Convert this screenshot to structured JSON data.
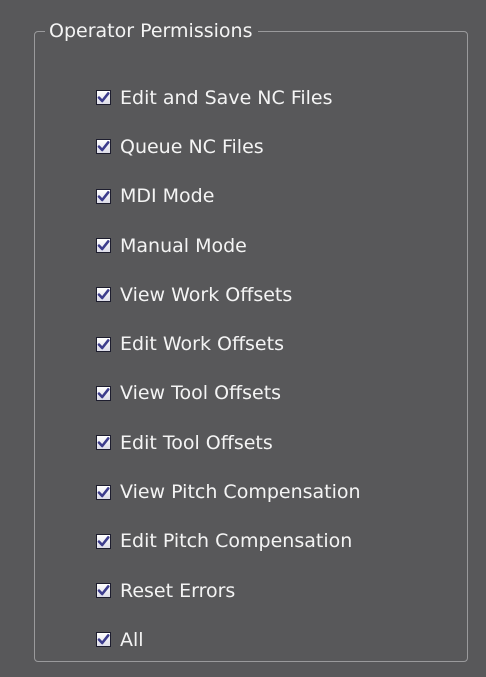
{
  "group": {
    "title": "Operator Permissions"
  },
  "colors": {
    "background": "#58585a",
    "border": "#9a9a9c",
    "text": "#f4f4f4",
    "checkmark": "#3c3c8c"
  },
  "permissions": [
    {
      "label": "Edit and Save NC Files",
      "checked": true
    },
    {
      "label": "Queue NC Files",
      "checked": true
    },
    {
      "label": "MDI Mode",
      "checked": true
    },
    {
      "label": "Manual Mode",
      "checked": true
    },
    {
      "label": "View Work Offsets",
      "checked": true
    },
    {
      "label": "Edit Work Offsets",
      "checked": true
    },
    {
      "label": "View Tool Offsets",
      "checked": true
    },
    {
      "label": "Edit Tool Offsets",
      "checked": true
    },
    {
      "label": "View Pitch Compensation",
      "checked": true
    },
    {
      "label": "Edit Pitch Compensation",
      "checked": true
    },
    {
      "label": "Reset Errors",
      "checked": true
    },
    {
      "label": "All",
      "checked": true
    }
  ]
}
